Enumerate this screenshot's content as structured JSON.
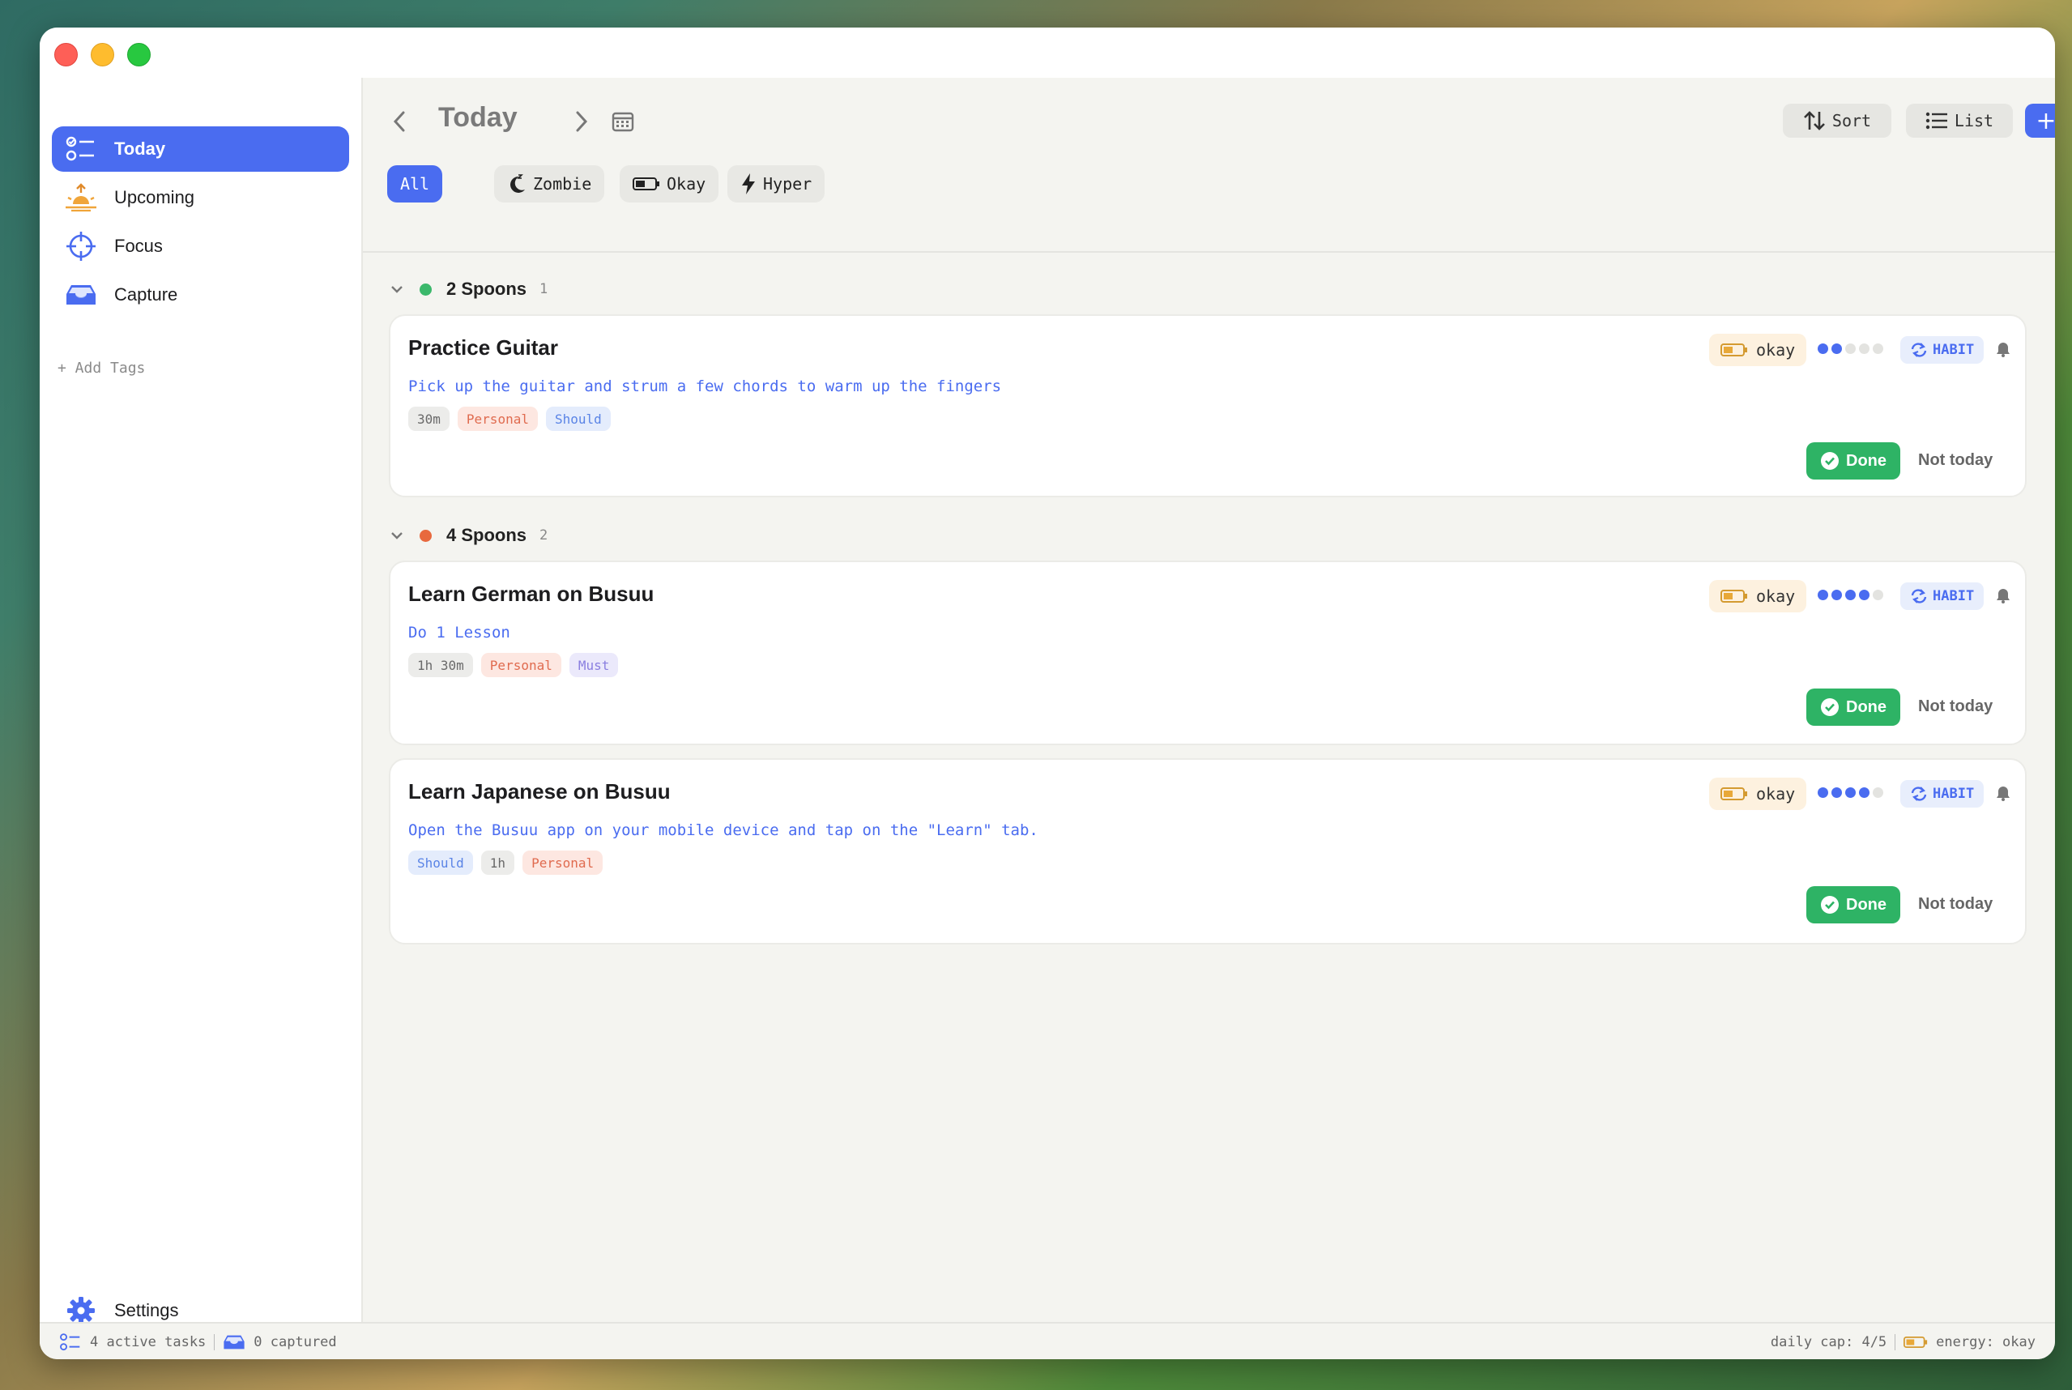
{
  "sidebar": {
    "items": [
      {
        "label": "Today",
        "icon": "checklist-icon",
        "active": true
      },
      {
        "label": "Upcoming",
        "icon": "sunrise-icon",
        "active": false
      },
      {
        "label": "Focus",
        "icon": "crosshair-icon",
        "active": false
      },
      {
        "label": "Capture",
        "icon": "inbox-tray-icon",
        "active": false
      }
    ],
    "add_tags": "+ Add Tags",
    "settings": "Settings"
  },
  "header": {
    "title": "Today",
    "sort_label": "Sort",
    "list_label": "List",
    "add_label": "+"
  },
  "filters": [
    "All",
    "Zombie",
    "Okay",
    "Hyper"
  ],
  "groups": [
    {
      "title": "2 Spoons",
      "count": "1",
      "color": "#3bb86b",
      "tasks": [
        {
          "title": "Practice Guitar",
          "description": "Pick up the guitar and strum a few chords to warm up the fingers",
          "tags": [
            {
              "text": "30m",
              "kind": "dur"
            },
            {
              "text": "Personal",
              "kind": "personal"
            },
            {
              "text": "Should",
              "kind": "should"
            }
          ],
          "energy": "okay",
          "spoons": 2,
          "habit": "HABIT",
          "done": "Done",
          "not_today": "Not today"
        }
      ]
    },
    {
      "title": "4 Spoons",
      "count": "2",
      "color": "#e8693e",
      "tasks": [
        {
          "title": "Learn German on Busuu",
          "description": "Do 1 Lesson",
          "tags": [
            {
              "text": "1h 30m",
              "kind": "dur"
            },
            {
              "text": "Personal",
              "kind": "personal"
            },
            {
              "text": "Must",
              "kind": "must"
            }
          ],
          "energy": "okay",
          "spoons": 4,
          "habit": "HABIT",
          "done": "Done",
          "not_today": "Not today"
        },
        {
          "title": "Learn Japanese on Busuu",
          "description": "Open the Busuu app on your mobile device and tap on the \"Learn\" tab.",
          "tags": [
            {
              "text": "Should",
              "kind": "should"
            },
            {
              "text": "1h",
              "kind": "dur"
            },
            {
              "text": "Personal",
              "kind": "personal"
            }
          ],
          "energy": "okay",
          "spoons": 4,
          "habit": "HABIT",
          "done": "Done",
          "not_today": "Not today"
        }
      ]
    }
  ],
  "statusbar": {
    "active_tasks": "4 active tasks",
    "captured": "0 captured",
    "daily_cap": "daily cap: 4/5",
    "energy": "energy: okay"
  },
  "colors": {
    "accent": "#4a6cf0",
    "done": "#2eb365",
    "energy_badge": "#fdf1df"
  }
}
